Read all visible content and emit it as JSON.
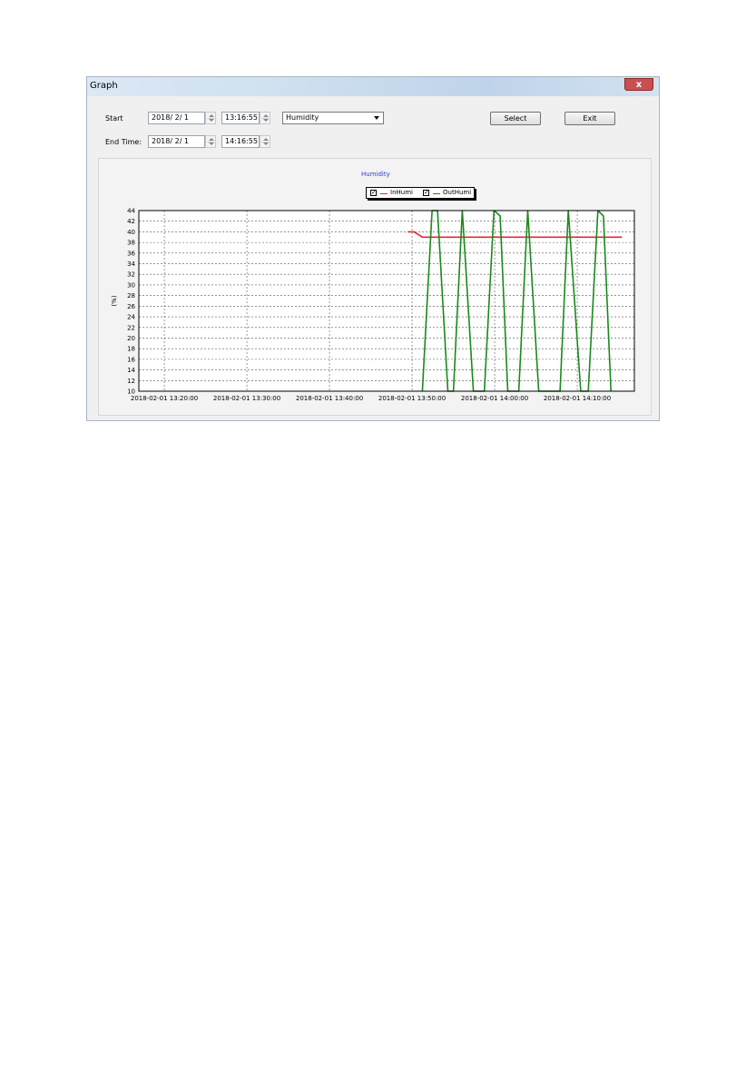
{
  "window": {
    "title": "Graph",
    "close_glyph": "x"
  },
  "controls": {
    "start_label": "Start",
    "start_date": "2018/ 2/ 1",
    "start_time": "13:16:55",
    "end_label": "End Time:",
    "end_date": "2018/ 2/ 1",
    "end_time": "14:16:55",
    "sensor_select": "Humidity",
    "select_button": "Select",
    "exit_button": "Exit"
  },
  "legend": {
    "check_glyph": "✓"
  },
  "chart_data": {
    "type": "line",
    "title": "Humidity",
    "xlabel": "",
    "ylabel": "(%)",
    "xlim": [
      "2018-02-01 13:16:55",
      "2018-02-01 14:16:55"
    ],
    "ylim": [
      10,
      44
    ],
    "y_ticks": [
      10,
      12,
      14,
      16,
      18,
      20,
      22,
      24,
      26,
      28,
      30,
      32,
      34,
      36,
      38,
      40,
      42,
      44
    ],
    "x_ticks": [
      {
        "t": "2018-02-01 13:20:00",
        "label": "2018-02-01 13:20:00"
      },
      {
        "t": "2018-02-01 13:30:00",
        "label": "2018-02-01 13:30:00"
      },
      {
        "t": "2018-02-01 13:40:00",
        "label": "2018-02-01 13:40:00"
      },
      {
        "t": "2018-02-01 13:50:00",
        "label": "2018-02-01 13:50:00"
      },
      {
        "t": "2018-02-01 14:00:00",
        "label": "2018-02-01 14:00:00"
      },
      {
        "t": "2018-02-01 14:10:00",
        "label": "2018-02-01 14:10:00"
      }
    ],
    "grid": true,
    "legend_position": "top-center",
    "series": [
      {
        "name": "InHumi",
        "color": "#e0263c",
        "points": [
          [
            "2018-02-01 13:49:30",
            40
          ],
          [
            "2018-02-01 13:50:15",
            40
          ],
          [
            "2018-02-01 13:51:15",
            39
          ],
          [
            "2018-02-01 14:03:00",
            39
          ],
          [
            "2018-02-01 14:15:25",
            39
          ]
        ]
      },
      {
        "name": "OutHumi",
        "color": "#1a8a1a",
        "points": [
          [
            "2018-02-01 13:51:15",
            10
          ],
          [
            "2018-02-01 13:52:25",
            44
          ],
          [
            "2018-02-01 13:53:05",
            44
          ],
          [
            "2018-02-01 13:54:20",
            10
          ],
          [
            "2018-02-01 13:55:00",
            10
          ],
          [
            "2018-02-01 13:56:05",
            44
          ],
          [
            "2018-02-01 13:57:25",
            10
          ],
          [
            "2018-02-01 13:58:45",
            10
          ],
          [
            "2018-02-01 13:59:55",
            44
          ],
          [
            "2018-02-01 14:00:40",
            43
          ],
          [
            "2018-02-01 14:01:35",
            10
          ],
          [
            "2018-02-01 14:02:55",
            10
          ],
          [
            "2018-02-01 14:04:00",
            44
          ],
          [
            "2018-02-01 14:05:20",
            10
          ],
          [
            "2018-02-01 14:07:55",
            10
          ],
          [
            "2018-02-01 14:08:55",
            44
          ],
          [
            "2018-02-01 14:10:25",
            10
          ],
          [
            "2018-02-01 14:11:20",
            10
          ],
          [
            "2018-02-01 14:12:30",
            44
          ],
          [
            "2018-02-01 14:13:10",
            43
          ],
          [
            "2018-02-01 14:14:05",
            10
          ]
        ]
      }
    ]
  }
}
